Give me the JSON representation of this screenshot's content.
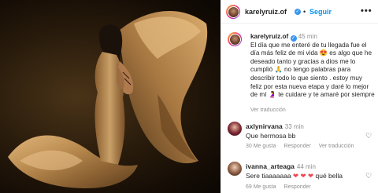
{
  "post": {
    "username": "karelyruiz.of",
    "follow_label": "Seguir",
    "separator": "•",
    "more_label": "•••"
  },
  "caption": {
    "username": "karelyruiz.of",
    "time": "45 min",
    "text": "El día que me enteré de tu llegada fue el día más feliz de mi vida 😍 es algo que he deseado tanto y gracias a dios me lo cumplió 🙏 no tengo palabras para describir todo lo que siento . estoy muy feliz por esta nueva etapa y daré lo mejor de mí 🤰 te cuidare y te amaré por siempre",
    "translate_label": "Ver traducción"
  },
  "comments": [
    {
      "username": "axlynirvana",
      "time": "33 min",
      "text": "Que hermosa bb",
      "likes": "30 Me gusta",
      "reply_label": "Responder",
      "translate_label": "Ver traducción"
    },
    {
      "username": "ivanna_arteaga",
      "time": "44 min",
      "text": "Sere tiaaaaaaa",
      "text_suffix": "qué bella",
      "likes": "69 Me gusta",
      "reply_label": "Responder"
    }
  ],
  "colors": {
    "accent": "#0095f6",
    "verified": "#3897f0",
    "heart_red": "#ed4956",
    "muted": "#8e8e8e",
    "dress_gold": "#b8894e"
  },
  "icons": {
    "verified": "verified-badge-icon",
    "more": "more-options-icon",
    "like": "heart-icon"
  }
}
